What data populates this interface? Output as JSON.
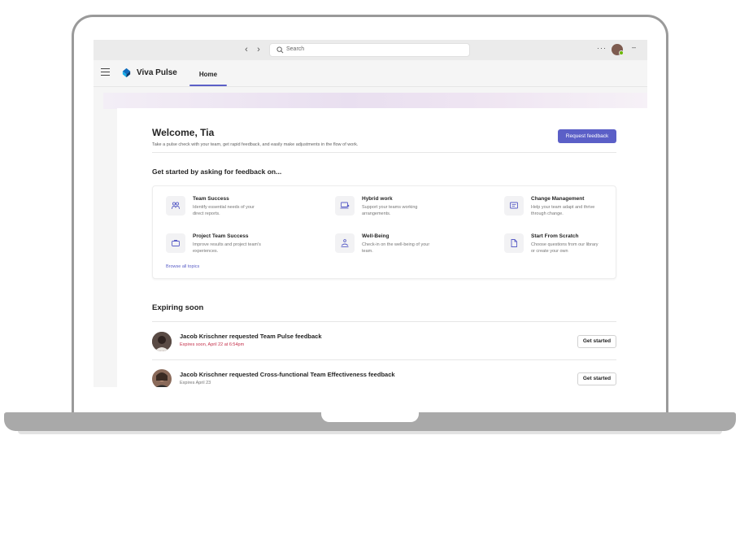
{
  "titlebar": {
    "back_icon": "chevron-left",
    "forward_icon": "chevron-right",
    "search_placeholder": "Search",
    "more_label": "···",
    "minimize_label": "–"
  },
  "app": {
    "name": "Viva Pulse",
    "tabs": [
      {
        "label": "Home",
        "selected": true
      }
    ]
  },
  "welcome": {
    "title": "Welcome, Tia",
    "subtitle": "Take a pulse check with your team, get rapid feedback, and easily make adjustments in the flow of work.",
    "request_button": "Request feedback"
  },
  "get_started": {
    "heading": "Get started by asking for feedback on...",
    "topics": [
      {
        "title": "Team Success",
        "description": "Identify essential needs of your direct reports.",
        "icon": "people-team-icon"
      },
      {
        "title": "Hybrid work",
        "description": "Support your teams working arrangements.",
        "icon": "laptop-person-icon"
      },
      {
        "title": "Change Management",
        "description": "Help your team adapt and thrive through change.",
        "icon": "board-icon"
      },
      {
        "title": "Project Team Success",
        "description": "Improve results and project team's experiences.",
        "icon": "briefcase-icon"
      },
      {
        "title": "Well-Being",
        "description": "Check-in on the well-being of your team.",
        "icon": "wellbeing-icon"
      },
      {
        "title": "Start From Scratch",
        "description": "Choose questions from our library or create your own",
        "icon": "document-icon"
      }
    ],
    "browse_link": "Browse all topics"
  },
  "expiring": {
    "heading": "Expiring soon",
    "items": [
      {
        "title": "Jacob Krischner requested Team Pulse feedback",
        "subtitle": "Expires soon, April 22 at 6:54pm",
        "button": "Get started",
        "urgent": true
      },
      {
        "title": "Jacob Krischner requested Cross-functional Team Effectiveness feedback",
        "subtitle": "Expires April 23",
        "button": "Get started",
        "urgent": false
      }
    ]
  },
  "colors": {
    "accent": "#5b5fc7",
    "urgent_text": "#c4314b",
    "muted_text": "#757575"
  }
}
